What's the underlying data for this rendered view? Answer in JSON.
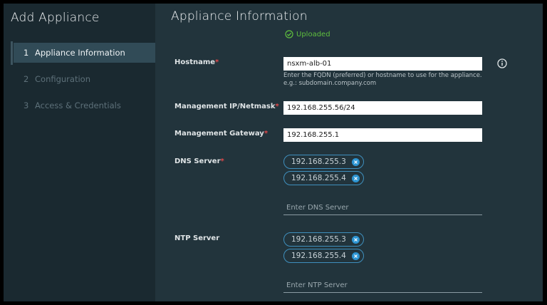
{
  "sidebar": {
    "title": "Add Appliance",
    "steps": [
      {
        "num": "1",
        "label": "Appliance Information"
      },
      {
        "num": "2",
        "label": "Configuration"
      },
      {
        "num": "3",
        "label": "Access & Credentials"
      }
    ]
  },
  "main": {
    "title": "Appliance Information",
    "upload_status": "Uploaded",
    "required_marker": "*",
    "hostname": {
      "label": "Hostname",
      "value": "nsxm-alb-01",
      "help_line1": "Enter the FQDN (preferred) or hostname to use for the appliance.",
      "help_line2": "e.g.: subdomain.company.com"
    },
    "management_ip": {
      "label": "Management IP/Netmask",
      "value": "192.168.255.56/24"
    },
    "management_gateway": {
      "label": "Management Gateway",
      "value": "192.168.255.1"
    },
    "dns": {
      "label": "DNS Server",
      "chips": [
        "192.168.255.3",
        "192.168.255.4"
      ],
      "placeholder": "Enter DNS Server"
    },
    "ntp": {
      "label": "NTP Server",
      "chips": [
        "192.168.255.3",
        "192.168.255.4"
      ],
      "placeholder": "Enter NTP Server"
    }
  },
  "colors": {
    "accent": "#2d95d3",
    "success": "#5fbf3e",
    "required": "#e0484a"
  }
}
